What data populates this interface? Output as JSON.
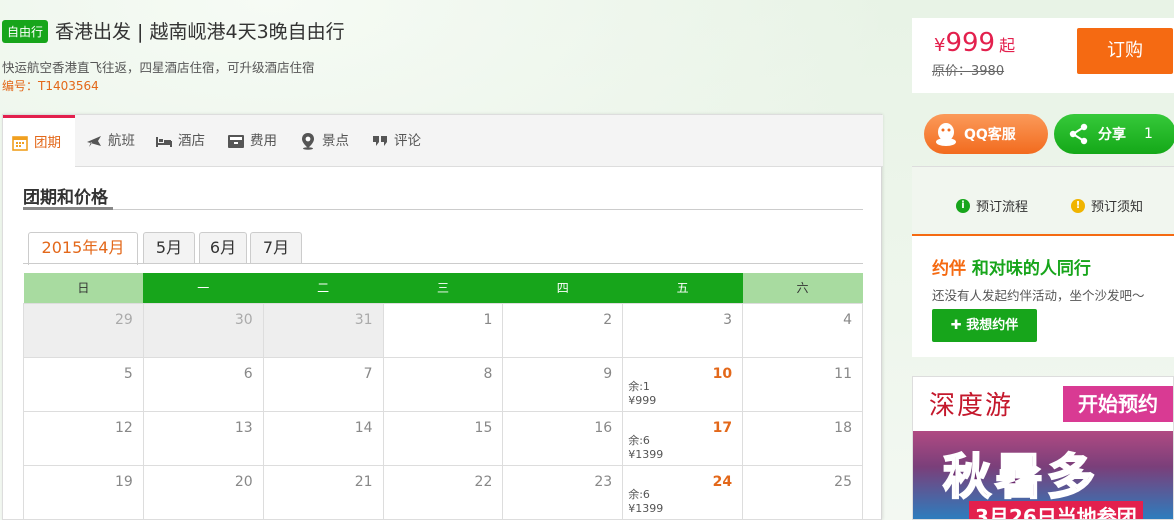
{
  "header": {
    "tag": "自由行",
    "title": "香港出发 | 越南岘港4天3晚自由行",
    "subtitle": "快运航空香港直飞往返，四星酒店住宿，可升级酒店住宿",
    "code": "编号：T1403564"
  },
  "price": {
    "currency": "¥",
    "amount": "999",
    "suffix": "起",
    "original": "原价：3980",
    "buy_label": "订购"
  },
  "tabs": [
    {
      "label": "团期",
      "icon": "calendar-icon"
    },
    {
      "label": "航班",
      "icon": "plane-icon"
    },
    {
      "label": "酒店",
      "icon": "bed-icon"
    },
    {
      "label": "费用",
      "icon": "wallet-icon"
    },
    {
      "label": "景点",
      "icon": "location-pin-icon"
    },
    {
      "label": "评论",
      "icon": "comment-icon"
    }
  ],
  "section": {
    "title": "团期和价格"
  },
  "months": [
    "2015年4月",
    "5月",
    "6月",
    "7月"
  ],
  "calendar": {
    "weekdays": [
      "日",
      "一",
      "二",
      "三",
      "四",
      "五",
      "六"
    ],
    "rows": [
      [
        {
          "d": "29",
          "prev": true
        },
        {
          "d": "30",
          "prev": true
        },
        {
          "d": "31",
          "prev": true
        },
        {
          "d": "1"
        },
        {
          "d": "2"
        },
        {
          "d": "3"
        },
        {
          "d": "4"
        }
      ],
      [
        {
          "d": "5"
        },
        {
          "d": "6"
        },
        {
          "d": "7"
        },
        {
          "d": "8"
        },
        {
          "d": "9"
        },
        {
          "d": "10",
          "hot": true,
          "rem": "余:1",
          "price": "¥999"
        },
        {
          "d": "11"
        }
      ],
      [
        {
          "d": "12"
        },
        {
          "d": "13"
        },
        {
          "d": "14"
        },
        {
          "d": "15"
        },
        {
          "d": "16"
        },
        {
          "d": "17",
          "hot": true,
          "rem": "余:6",
          "price": "¥1399"
        },
        {
          "d": "18"
        }
      ],
      [
        {
          "d": "19"
        },
        {
          "d": "20"
        },
        {
          "d": "21"
        },
        {
          "d": "22"
        },
        {
          "d": "23"
        },
        {
          "d": "24",
          "hot": true,
          "rem": "余:6",
          "price": "¥1399"
        },
        {
          "d": "25"
        }
      ]
    ]
  },
  "side": {
    "qq_label": "QQ客服",
    "share_label": "分享",
    "share_count": "1",
    "flow_label": "预订流程",
    "notice_label": "预订须知",
    "mate_logo": "约伴",
    "mate_title": "和对味的人同行",
    "mate_text": "还没有人发起约伴活动，坐个沙发吧～",
    "mate_button": "我想约伴"
  },
  "ad": {
    "brand": "深度游",
    "start": "开始预约",
    "big": "秋暑多",
    "date": "3月26日当地参团"
  },
  "colors": {
    "accent_green": "#17a51b",
    "accent_orange": "#f56a12",
    "price_red": "#e3204d"
  }
}
